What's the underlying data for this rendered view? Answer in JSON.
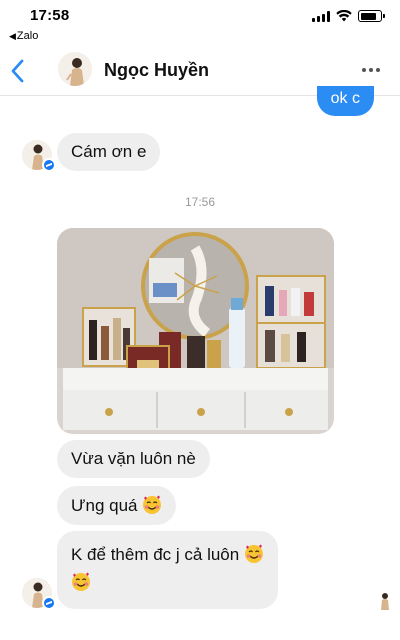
{
  "status_bar": {
    "time": "17:58",
    "back_app": "Zalo"
  },
  "header": {
    "contact_name": "Ngọc Huyền"
  },
  "messages": {
    "outgoing_top": "ok c",
    "incoming_1": "Cám ơn e",
    "timestamp": "17:56",
    "incoming_2": "Vừa vặn luôn nè",
    "incoming_3": "Ưng quá",
    "incoming_4": "K để thêm đc j cả luôn"
  },
  "colors": {
    "accent": "#2b8cf3",
    "incoming_bubble": "#eeeeee",
    "messenger_badge": "#1877f2"
  },
  "icons": [
    "back-chevron-icon",
    "more-icon",
    "smiling-face-with-hearts-emoji",
    "messenger-badge-icon"
  ]
}
